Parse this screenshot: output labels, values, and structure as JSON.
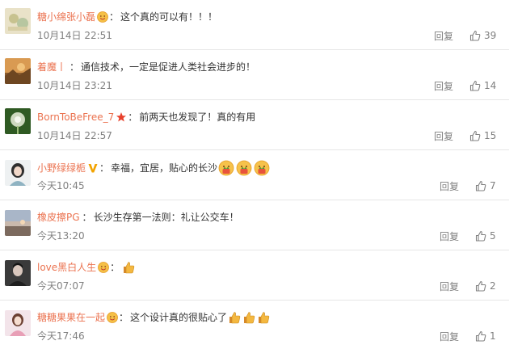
{
  "comments": [
    {
      "username": "糖小绵张小磊",
      "separator": "：",
      "text": "这个真的可以有！！！",
      "date": "10月14日 22:51",
      "reply_label": "回复",
      "like_count": "39",
      "icons": {
        "avatar": "avatar-beige-pattern",
        "badge": "smiley-badge-icon"
      }
    },
    {
      "username": "着魔丨",
      "separator": "：",
      "text": "通信技术，一定是促进人类社会进步的！",
      "date": "10月14日 23:21",
      "reply_label": "回复",
      "like_count": "14",
      "icons": {
        "avatar": "avatar-orange-landscape"
      }
    },
    {
      "username": "BornToBeFree_7",
      "separator": "：",
      "text": "前两天也发现了！真的有用",
      "date": "10月14日 22:57",
      "reply_label": "回复",
      "like_count": "15",
      "icons": {
        "avatar": "avatar-green-dandelion",
        "badge": "red-star-icon"
      }
    },
    {
      "username": "小野绿绿栀",
      "separator": "：",
      "text": "幸福，宜居，贴心的长沙",
      "date": "今天10:45",
      "reply_label": "回复",
      "like_count": "7",
      "icons": {
        "avatar": "avatar-girl-portrait",
        "badge": "yellow-v-badge-icon",
        "emojis": [
          "rose-emoji",
          "rose-emoji",
          "rose-emoji"
        ]
      }
    },
    {
      "username": "橡皮擦PG",
      "separator": "：",
      "text": "长沙生存第一法则：礼让公交车！",
      "date": "今天13:20",
      "reply_label": "回复",
      "like_count": "5",
      "icons": {
        "avatar": "avatar-sunset-sky"
      }
    },
    {
      "username": "love黑白人生",
      "separator": "：",
      "text": "",
      "date": "今天07:07",
      "reply_label": "回复",
      "like_count": "2",
      "icons": {
        "avatar": "avatar-dark-portrait",
        "badge": "smiley-badge-icon",
        "emojis": [
          "thumbs-up-emoji"
        ]
      }
    },
    {
      "username": "糖糖果果在一起",
      "separator": "：",
      "text": "这个设计真的很贴心了",
      "date": "今天17:46",
      "reply_label": "回复",
      "like_count": "1",
      "icons": {
        "avatar": "avatar-pink-girl",
        "badge": "smiley-badge-icon",
        "emojis": [
          "thumbs-up-emoji",
          "thumbs-up-emoji",
          "thumbs-up-emoji"
        ]
      }
    }
  ],
  "colors": {
    "username": "#eb7350",
    "text": "#333333",
    "meta": "#808080",
    "divider": "#e6e6e6"
  }
}
